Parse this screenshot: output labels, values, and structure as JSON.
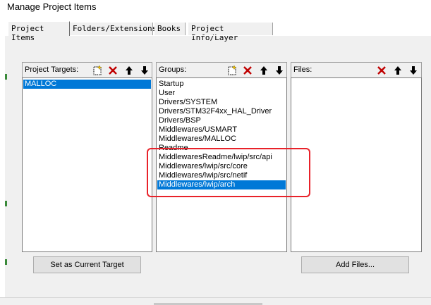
{
  "window": {
    "title": "Manage Project Items"
  },
  "tabs": [
    {
      "label": "Project Items",
      "active": true
    },
    {
      "label": "Folders/Extensions",
      "active": false
    },
    {
      "label": "Books",
      "active": false
    },
    {
      "label": "Project Info/Layer",
      "active": false
    }
  ],
  "targets": {
    "label": "Project Targets:",
    "items": [
      {
        "text": "MALLOC",
        "selected": true
      }
    ],
    "toolbar": [
      "new-icon",
      "delete-icon",
      "move-up-icon",
      "move-down-icon"
    ]
  },
  "groups": {
    "label": "Groups:",
    "items": [
      {
        "text": "Startup",
        "selected": false
      },
      {
        "text": "User",
        "selected": false
      },
      {
        "text": "Drivers/SYSTEM",
        "selected": false
      },
      {
        "text": "Drivers/STM32F4xx_HAL_Driver",
        "selected": false
      },
      {
        "text": "Drivers/BSP",
        "selected": false
      },
      {
        "text": "Middlewares/USMART",
        "selected": false
      },
      {
        "text": "Middlewares/MALLOC",
        "selected": false
      },
      {
        "text": "Readme",
        "selected": false
      },
      {
        "text": "MiddlewaresReadme/lwip/src/api",
        "selected": false
      },
      {
        "text": "Middlewares/lwip/src/core",
        "selected": false
      },
      {
        "text": "Middlewares/lwip/src/netif",
        "selected": false
      },
      {
        "text": "Middlewares/lwip/arch",
        "selected": true
      }
    ],
    "toolbar": [
      "new-icon",
      "delete-icon",
      "move-up-icon",
      "move-down-icon"
    ]
  },
  "files": {
    "label": "Files:",
    "items": [],
    "toolbar": [
      "delete-icon",
      "move-up-icon",
      "move-down-icon"
    ]
  },
  "buttons": {
    "set_target": "Set as Current Target",
    "add_files": "Add Files..."
  },
  "colors": {
    "selection": "#0078d7",
    "annotation": "#e8222a",
    "delete": "#c00000"
  }
}
